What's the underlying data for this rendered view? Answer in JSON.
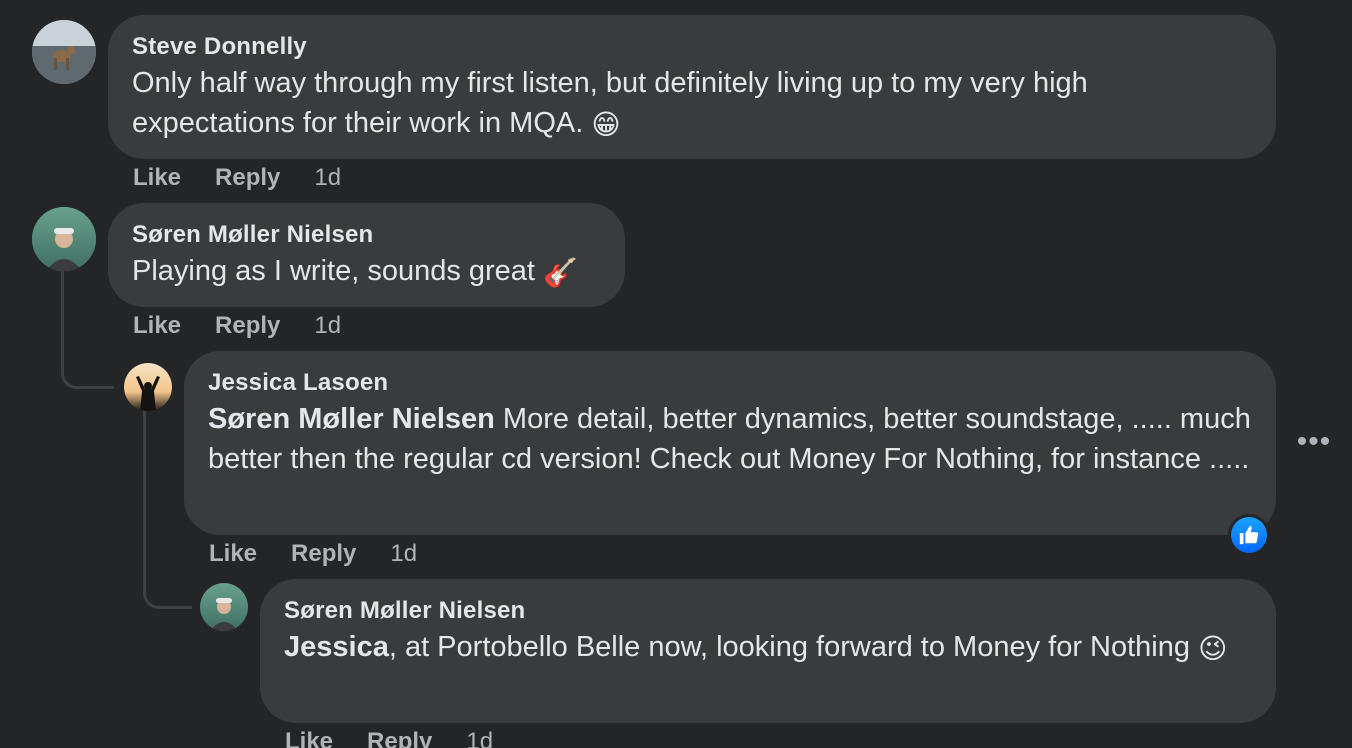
{
  "comments": [
    {
      "author": "Steve Donnelly",
      "text": "Only half way through my first listen, but definitely living up to my very high expectations for their work in MQA.",
      "emoji": "😁",
      "like": "Like",
      "reply": "Reply",
      "time": "1d"
    },
    {
      "author": "Søren Møller Nielsen",
      "text": "Playing as I write, sounds great",
      "emoji": "🎸",
      "like": "Like",
      "reply": "Reply",
      "time": "1d"
    },
    {
      "author": "Jessica Lasoen",
      "mention": "Søren Møller Nielsen",
      "text": " More detail, better dynamics, better soundstage, ..... much better then the regular cd version! Check out Money For Nothing, for instance .....",
      "like": "Like",
      "reply": "Reply",
      "time": "1d",
      "reaction_icon": "thumbs-up-icon"
    },
    {
      "author": "Søren Møller Nielsen",
      "mention": "Jessica",
      "text": ", at Portobello Belle now, looking forward to Money for Nothing",
      "emoji": "😉",
      "like": "Like",
      "reply": "Reply",
      "time": "1d"
    }
  ],
  "more_options": "•••",
  "colors": {
    "background": "#242526",
    "bubble": "#3a3b3c",
    "text": "#e4e6eb",
    "secondary": "#b0b3b8",
    "reaction": "#0866ff"
  }
}
